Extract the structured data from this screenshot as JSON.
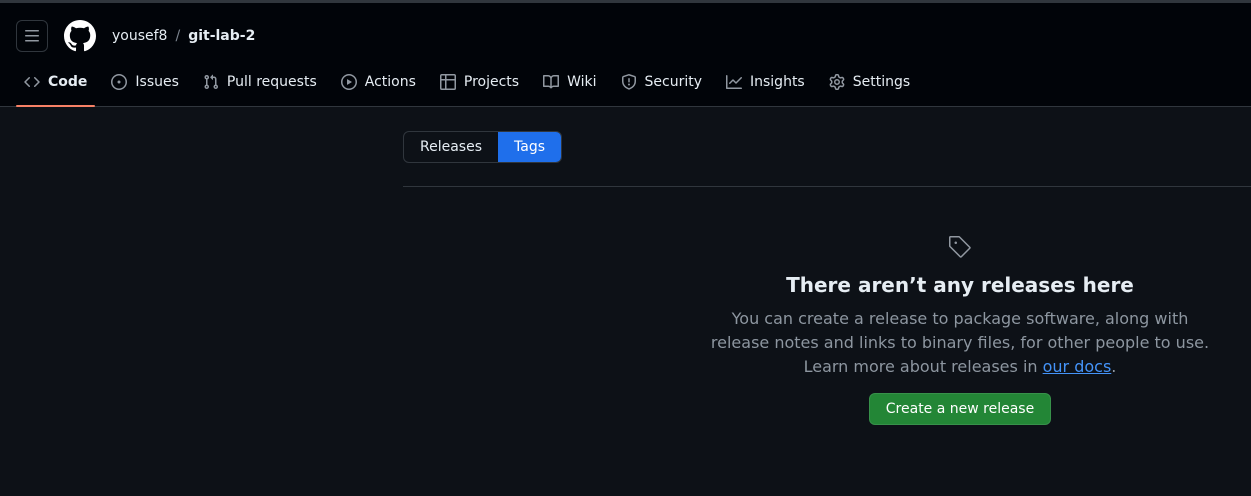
{
  "header": {
    "owner": "yousef8",
    "separator": "/",
    "repo": "git-lab-2"
  },
  "tabs": [
    {
      "label": "Code",
      "icon": "code-icon",
      "active": true
    },
    {
      "label": "Issues",
      "icon": "issue-icon"
    },
    {
      "label": "Pull requests",
      "icon": "pull-request-icon"
    },
    {
      "label": "Actions",
      "icon": "play-icon"
    },
    {
      "label": "Projects",
      "icon": "table-icon"
    },
    {
      "label": "Wiki",
      "icon": "book-icon"
    },
    {
      "label": "Security",
      "icon": "shield-icon"
    },
    {
      "label": "Insights",
      "icon": "graph-icon"
    },
    {
      "label": "Settings",
      "icon": "gear-icon"
    }
  ],
  "subnav": {
    "releases": "Releases",
    "tags": "Tags",
    "selected": "Tags"
  },
  "blankslate": {
    "icon": "tag-icon",
    "title": "There aren’t any releases here",
    "text_before": "You can create a release to package software, along with release notes and links to binary files, for other people to use. Learn more about releases in ",
    "link": "our docs",
    "text_after": ".",
    "button": "Create a new release"
  },
  "colors": {
    "accent": "#1f6feb",
    "active_tab_underline": "#f78166",
    "primary_button": "#238636",
    "link": "#4493f8"
  }
}
